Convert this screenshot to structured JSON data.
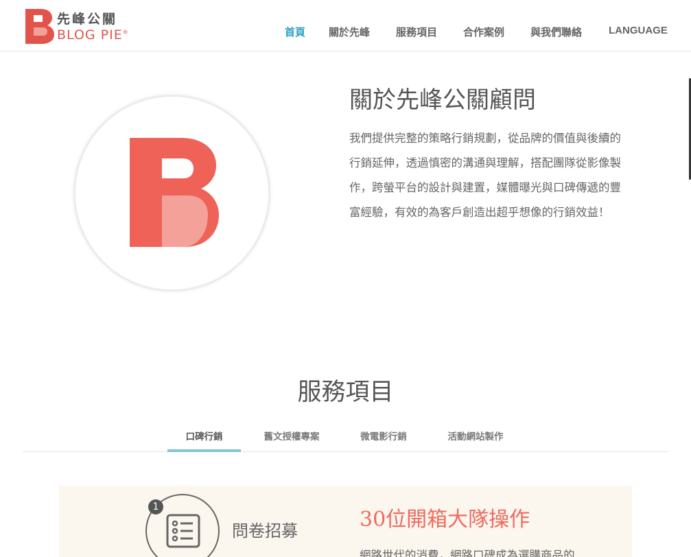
{
  "brand": {
    "name_cn": "先峰公關",
    "name_en": "BLOG PIE",
    "mark": "®",
    "color_red": "#e2544b",
    "color_pink": "#f2a09a"
  },
  "nav": {
    "items": [
      {
        "label": "首頁",
        "active": true
      },
      {
        "label": "關於先峰"
      },
      {
        "label": "服務項目"
      },
      {
        "label": "合作案例"
      },
      {
        "label": "與我們聯絡"
      },
      {
        "label": "LANGUAGE"
      }
    ],
    "active_color": "#29a0c7"
  },
  "about": {
    "title": "關於先峰公關顧問",
    "text": "我們提供完整的策略行銷規劃，從品牌的價值與後續的行銷延伸，透過慎密的溝通與理解，搭配團隊從影像製作，跨螢平台的設計與建置，媒體曝光與口碑傳遞的豐富經驗，有效的為客戶創造出超乎想像的行銷效益！"
  },
  "services": {
    "title": "服務項目",
    "tabs": [
      {
        "label": "口碑行銷",
        "active": true
      },
      {
        "label": "舊文授權專案"
      },
      {
        "label": "微電影行銷"
      },
      {
        "label": "活動網站製作"
      }
    ],
    "card": {
      "step_number": "1",
      "step_label": "問卷招募",
      "step_icon": "list-icon",
      "title": "30位開箱大隊操作",
      "text": "網路世代的消費，網路口碑成為選購商品的"
    }
  }
}
